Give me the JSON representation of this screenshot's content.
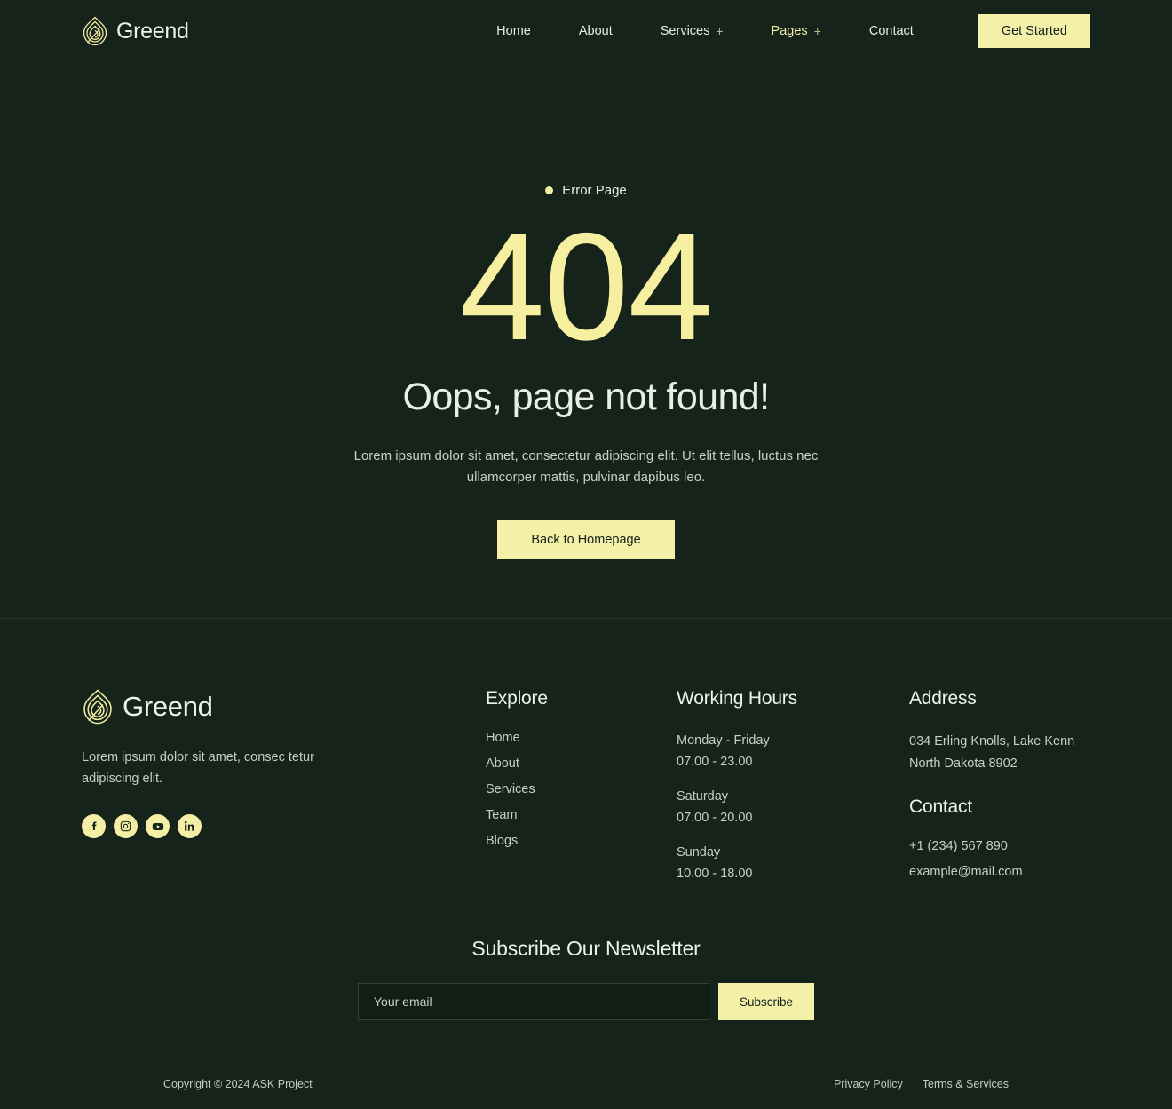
{
  "brand": {
    "name": "Greend",
    "logo_icon": "greend-leaf-logo-icon"
  },
  "header": {
    "nav": [
      {
        "label": "Home",
        "has_plus": false,
        "active": false
      },
      {
        "label": "About",
        "has_plus": false,
        "active": false
      },
      {
        "label": "Services",
        "has_plus": true,
        "plus": "+",
        "active": false
      },
      {
        "label": "Pages",
        "has_plus": true,
        "plus": "+",
        "active": true
      },
      {
        "label": "Contact",
        "has_plus": false,
        "active": false
      }
    ],
    "cta_label": "Get Started"
  },
  "hero": {
    "eyebrow": "Error Page",
    "code": "404",
    "title": "Oops, page not found!",
    "description": "Lorem ipsum dolor sit amet, consectetur adipiscing elit. Ut elit tellus, luctus nec ullamcorper mattis, pulvinar dapibus leo.",
    "button_label": "Back to Homepage"
  },
  "footer": {
    "about": "Lorem ipsum dolor sit amet, consec tetur adipiscing elit.",
    "socials": [
      {
        "name": "facebook-icon",
        "label": "Facebook"
      },
      {
        "name": "instagram-icon",
        "label": "Instagram"
      },
      {
        "name": "youtube-icon",
        "label": "YouTube"
      },
      {
        "name": "linkedin-icon",
        "label": "LinkedIn"
      }
    ],
    "explore": {
      "title": "Explore",
      "links": [
        "Home",
        "About",
        "Services",
        "Team",
        "Blogs"
      ]
    },
    "working_hours": {
      "title": "Working Hours",
      "entries": [
        {
          "day": "Monday - Friday",
          "time": "07.00 - 23.00"
        },
        {
          "day": "Saturday",
          "time": "07.00 - 20.00"
        },
        {
          "day": "Sunday",
          "time": "10.00 - 18.00"
        }
      ]
    },
    "address": {
      "title": "Address",
      "lines": [
        "034 Erling Knolls, Lake Kenn",
        "North Dakota 8902"
      ]
    },
    "contact": {
      "title": "Contact",
      "phone": "+1 (234) 567 890",
      "email": "example@mail.com"
    },
    "newsletter": {
      "title": "Subscribe Our Newsletter",
      "placeholder": "Your email",
      "value": "",
      "button_label": "Subscribe"
    }
  },
  "bottombar": {
    "copyright": "Copyright © 2024 ASK Project",
    "links": [
      "Privacy Policy",
      "Terms & Services"
    ]
  },
  "colors": {
    "background": "#16231a",
    "accent": "#f4f0a8",
    "text": "#e9eee6",
    "muted": "#c8d0c5"
  }
}
